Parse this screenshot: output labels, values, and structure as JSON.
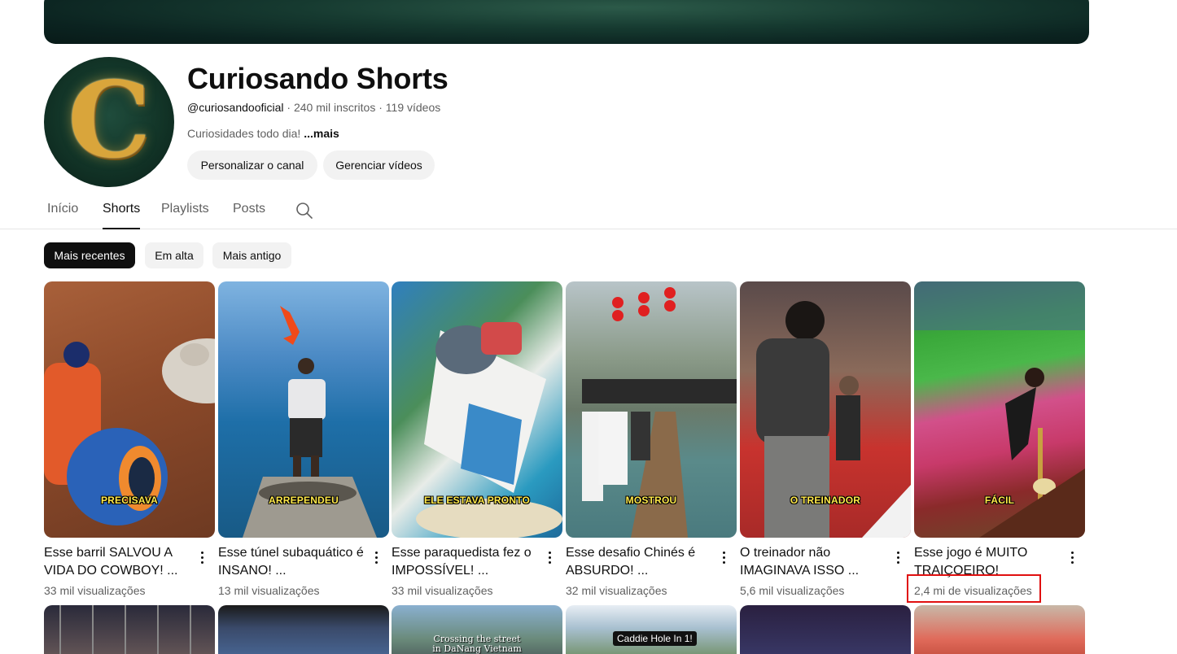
{
  "channel": {
    "name": "Curiosando Shorts",
    "avatar_letter": "C",
    "handle": "@curiosandooficial",
    "subscribers": "240 mil inscritos",
    "video_count": "119 vídeos",
    "separator": "·",
    "description": "Curiosidades todo dia!",
    "more_label": "...mais",
    "customize_label": "Personalizar o canal",
    "manage_label": "Gerenciar vídeos"
  },
  "tabs": [
    {
      "label": "Início"
    },
    {
      "label": "Shorts"
    },
    {
      "label": "Playlists"
    },
    {
      "label": "Posts"
    }
  ],
  "active_tab": "Shorts",
  "filters": [
    {
      "label": "Mais recentes"
    },
    {
      "label": "Em alta"
    },
    {
      "label": "Mais antigo"
    }
  ],
  "shorts": [
    {
      "title": "Esse barril SALVOU A VIDA DO COWBOY! ...",
      "views": "33 mil visualizações",
      "overlay": "PRECISAVA"
    },
    {
      "title": "Esse túnel subaquático é INSANO! ...",
      "views": "13 mil visualizações",
      "overlay": "ARREPENDEU"
    },
    {
      "title": "Esse paraquedista fez o IMPOSSÍVEL! ...",
      "views": "33 mil visualizações",
      "overlay": "ELE ESTAVA PRONTO"
    },
    {
      "title": "Esse desafio Chinés é ABSURDO! ...",
      "views": "32 mil visualizações",
      "overlay": "MOSTROU"
    },
    {
      "title": "O treinador não IMAGINAVA ISSO ...",
      "views": "5,6 mil visualizações",
      "overlay": "O TREINADOR"
    },
    {
      "title": "Esse jogo é MUITO TRAIÇOEIRO!",
      "views": "2,4 mi de visualizações",
      "overlay": "FÁCIL"
    }
  ],
  "second_row": {
    "crossing_text": "Crossing the street in DaNang Vietnam",
    "caddie_text": "Caddie Hole In 1!"
  },
  "colors": {
    "accent_highlight": "#e01010",
    "selected_chip": "#0f0f0f",
    "overlay_text": "#ffe94a"
  }
}
